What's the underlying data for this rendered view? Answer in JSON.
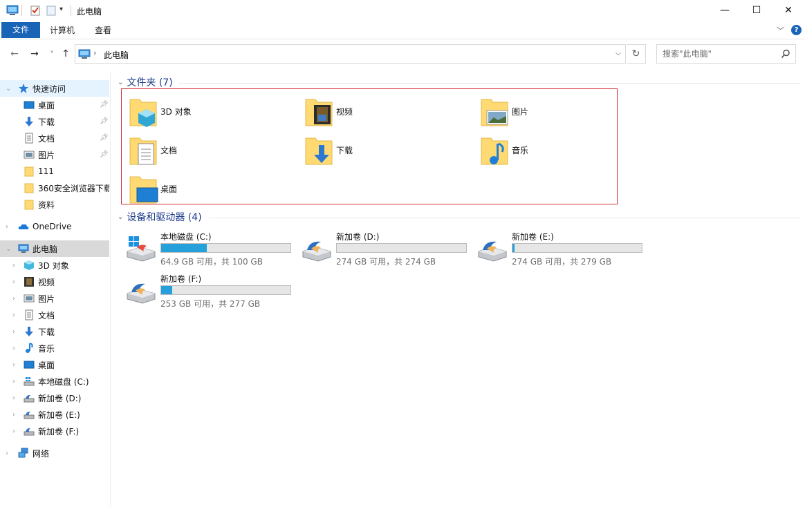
{
  "window": {
    "title": "此电脑",
    "minimize": "—",
    "maximize": "☐",
    "close": "✕"
  },
  "ribbon": {
    "tabs": [
      "文件",
      "计算机",
      "查看"
    ],
    "expand": "﹀",
    "help": "?"
  },
  "address": {
    "back": "←",
    "forward": "→",
    "recent": "˅",
    "up": "↑",
    "crumb_sep": "›",
    "crumb": "此电脑",
    "dropdown": "⌵",
    "refresh": "↻"
  },
  "search": {
    "placeholder": "搜索\"此电脑\""
  },
  "sidebar": {
    "quick_access": "快速访问",
    "quick_items": [
      "桌面",
      "下载",
      "文档",
      "图片",
      "111",
      "360安全浏览器下载",
      "资料"
    ],
    "onedrive": "OneDrive",
    "this_pc": "此电脑",
    "pc_items": [
      "3D 对象",
      "视频",
      "图片",
      "文档",
      "下载",
      "音乐",
      "桌面",
      "本地磁盘 (C:)",
      "新加卷 (D:)",
      "新加卷 (E:)",
      "新加卷 (F:)"
    ],
    "network": "网络"
  },
  "folders": {
    "header": "文件夹 (7)",
    "items": [
      "3D 对象",
      "视频",
      "图片",
      "文档",
      "下载",
      "音乐",
      "桌面"
    ]
  },
  "drives": {
    "header": "设备和驱动器 (4)",
    "items": [
      {
        "name": "本地磁盘 (C:)",
        "space": "64.9 GB 可用，共 100 GB",
        "used_fraction": 0.351
      },
      {
        "name": "新加卷 (D:)",
        "space": "274 GB 可用，共 274 GB",
        "used_fraction": 0.0
      },
      {
        "name": "新加卷 (E:)",
        "space": "274 GB 可用，共 279 GB",
        "used_fraction": 0.018
      },
      {
        "name": "新加卷 (F:)",
        "space": "253 GB 可用，共 277 GB",
        "used_fraction": 0.087
      }
    ]
  },
  "colors": {
    "accent": "#1a64b8",
    "selection_frame": "#d2333b",
    "group_title": "#1e3c8c",
    "drive_bar": "#26a0da"
  }
}
